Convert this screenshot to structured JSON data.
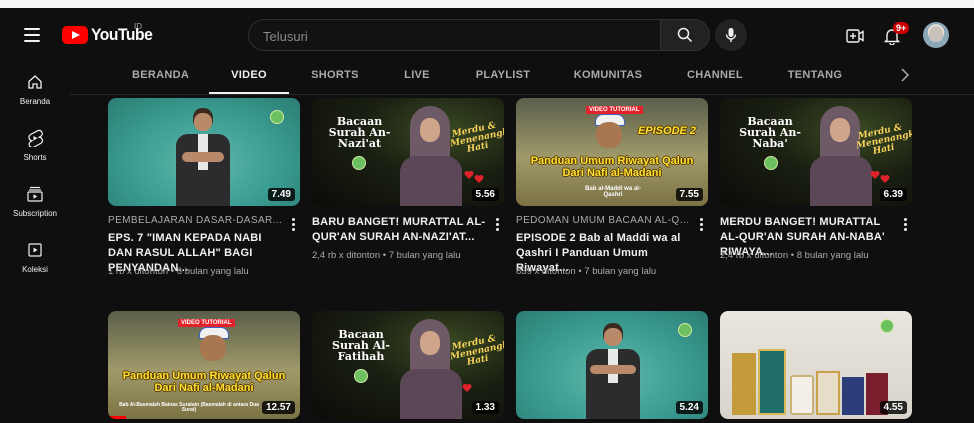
{
  "search": {
    "placeholder": "Telusuri"
  },
  "header": {
    "logo_text": "YouTube",
    "logo_country": "ID",
    "notifications_badge": "9+"
  },
  "sidebar": {
    "items": [
      {
        "label": "Beranda",
        "icon": "home-icon"
      },
      {
        "label": "Shorts",
        "icon": "shorts-icon"
      },
      {
        "label": "Subscription",
        "icon": "subscriptions-icon"
      },
      {
        "label": "Koleksi",
        "icon": "library-icon"
      }
    ]
  },
  "tabs": [
    "BERANDA",
    "VIDEO",
    "SHORTS",
    "LIVE",
    "PLAYLIST",
    "KOMUNITAS",
    "CHANNEL",
    "TENTANG"
  ],
  "active_tab": "VIDEO",
  "videos": [
    {
      "channel": "PEMBELAJARAN DASAR-DASAR...",
      "title": "EPS. 7 \"IMAN KEPADA NABI DAN RASUL ALLAH\" BAGI PENYANDAN...",
      "meta": "1 rb x ditonton • 6 bulan yang lalu",
      "duration": "7.49"
    },
    {
      "channel": "",
      "title": "BARU BANGET! MURATTAL AL-QUR'AN SURAH AN-NAZI'AT...",
      "meta": "2,4 rb x ditonton • 7 bulan yang lalu",
      "duration": "5.56",
      "thumb_title": "Bacaan Surah An-Nazi'at",
      "thumb_script": "Merdu & Menenangkan Hati"
    },
    {
      "channel": "PEDOMAN UMUM BACAAN AL-QUR'A...",
      "title": "EPISODE 2 Bab al Maddi wa al Qashri I Panduan Umum Riwayat...",
      "meta": "839 x ditonton • 7 bulan yang lalu",
      "duration": "7.55",
      "thumb_tag": "VIDEO TUTORIAL",
      "thumb_episode": "EPISODE 2",
      "thumb_title": "Panduan Umum Riwayat Qalun Dari Nafi al-Madani",
      "thumb_sub": "Bab al-Maddi wa al-Qashri"
    },
    {
      "channel": "",
      "title": "MERDU BANGET! MURATTAL AL-QUR'AN SURAH AN-NABA' RIWAYA...",
      "meta": "2,4 rb x ditonton • 8 bulan yang lalu",
      "duration": "6.39",
      "thumb_title": "Bacaan Surah An-Naba'",
      "thumb_script": "Merdu & Menenangkan Hati"
    },
    {
      "duration": "12.57",
      "thumb_tag": "VIDEO TUTORIAL",
      "thumb_title": "Panduan Umum Riwayat Qalun Dari Nafi al-Madani",
      "thumb_sub": "Bab Al-Basmalah Bainas Suratain (Basmalah di antara Dua Surat)"
    },
    {
      "duration": "1.33",
      "thumb_title": "Bacaan Surah Al-Fatihah",
      "thumb_script": "Merdu & Menenangkan Hati"
    },
    {
      "duration": "5.24"
    },
    {
      "duration": "4.55"
    }
  ],
  "colors": {
    "brand_red": "#ff0000",
    "background": "#0f0f0f",
    "secondary_text": "#aaaaaa"
  }
}
